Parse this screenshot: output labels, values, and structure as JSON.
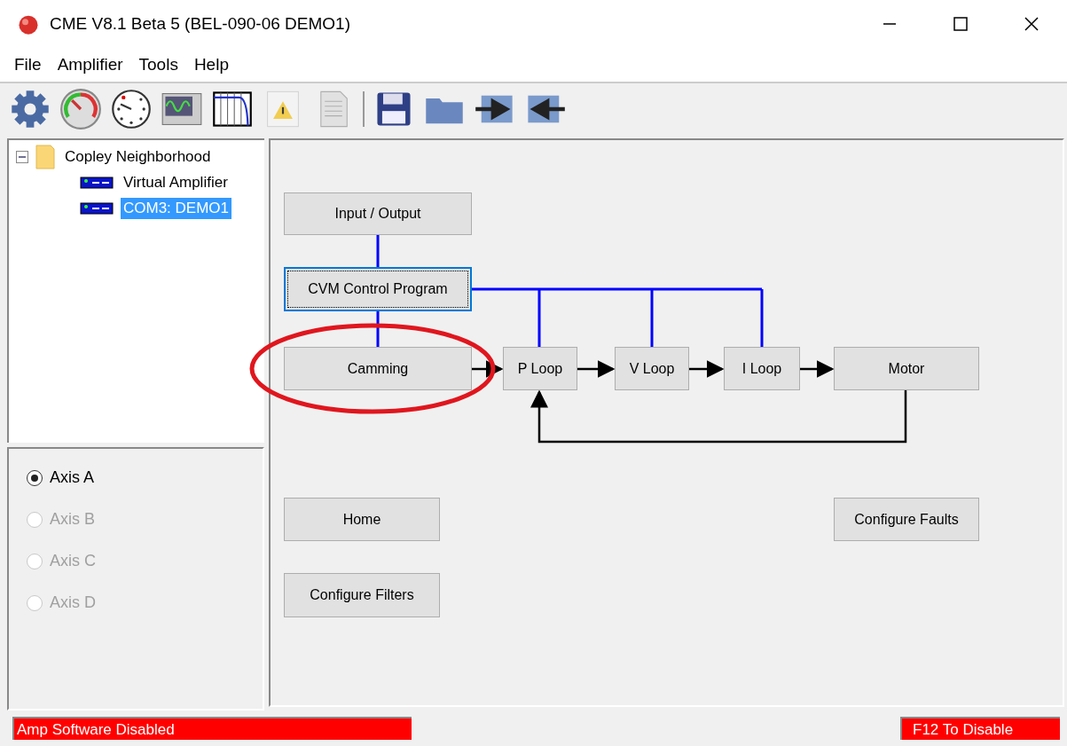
{
  "window": {
    "title": "CME V8.1 Beta 5 (BEL-090-06 DEMO1)"
  },
  "menu": [
    "File",
    "Amplifier",
    "Tools",
    "Help"
  ],
  "tree": {
    "label": "Copley Neighborhood",
    "expanded": true,
    "children": [
      {
        "label": "Virtual Amplifier",
        "selected": false
      },
      {
        "label": "COM3: DEMO1",
        "selected": true
      }
    ]
  },
  "axes": [
    {
      "label": "Axis A",
      "selected": true,
      "disabled": false
    },
    {
      "label": "Axis B",
      "selected": false,
      "disabled": true
    },
    {
      "label": "Axis C",
      "selected": false,
      "disabled": true
    },
    {
      "label": "Axis D",
      "selected": false,
      "disabled": true
    }
  ],
  "diagram": {
    "nodes": [
      {
        "label": "Input / Output",
        "focused": false,
        "highlighted": false
      },
      {
        "label": "CVM Control Program",
        "focused": true,
        "highlighted": false
      },
      {
        "label": "Camming",
        "focused": false,
        "highlighted": true
      },
      {
        "label": "P Loop",
        "focused": false,
        "highlighted": false
      },
      {
        "label": "V Loop",
        "focused": false,
        "highlighted": false
      },
      {
        "label": "I Loop",
        "focused": false,
        "highlighted": false
      },
      {
        "label": "Motor",
        "focused": false,
        "highlighted": false
      },
      {
        "label": "Home",
        "focused": false,
        "highlighted": false
      },
      {
        "label": "Configure Filters",
        "focused": false,
        "highlighted": false
      },
      {
        "label": "Configure Faults",
        "focused": false,
        "highlighted": false
      }
    ]
  },
  "status_bar": {
    "left": "Amp Software Disabled",
    "right": "F12 To Disable"
  }
}
